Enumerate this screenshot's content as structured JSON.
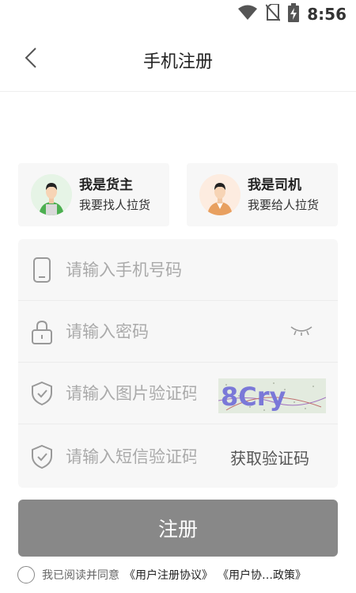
{
  "status_bar": {
    "time": "8:56",
    "icons": [
      "wifi-icon",
      "no-sim-icon",
      "battery-charging-icon"
    ]
  },
  "nav": {
    "title": "手机注册",
    "back_icon": "chevron-left-icon"
  },
  "roles": [
    {
      "title": "我是货主",
      "subtitle": "我要找人拉货",
      "icon": "shipper-avatar-icon",
      "color": "#4caf50"
    },
    {
      "title": "我是司机",
      "subtitle": "我要给人拉货",
      "icon": "driver-avatar-icon",
      "color": "#e8a060"
    }
  ],
  "form": {
    "phone": {
      "placeholder": "请输入手机号码",
      "value": "",
      "icon": "phone-icon"
    },
    "password": {
      "placeholder": "请输入密码",
      "value": "",
      "icon": "lock-icon",
      "toggle_icon": "eye-closed-icon"
    },
    "image_code": {
      "placeholder": "请输入图片验证码",
      "value": "",
      "icon": "shield-check-icon",
      "captcha_text": "8Cry"
    },
    "sms_code": {
      "placeholder": "请输入短信验证码",
      "value": "",
      "icon": "shield-check-icon",
      "get_code_label": "获取验证码"
    }
  },
  "register_label": "注册",
  "agreement": {
    "text": "我已阅读并同意",
    "link1": "《用户注册协议》",
    "link2": "《用户协…政策》"
  },
  "colors": {
    "register_button": "#888888",
    "form_background": "#f7f7f7"
  }
}
